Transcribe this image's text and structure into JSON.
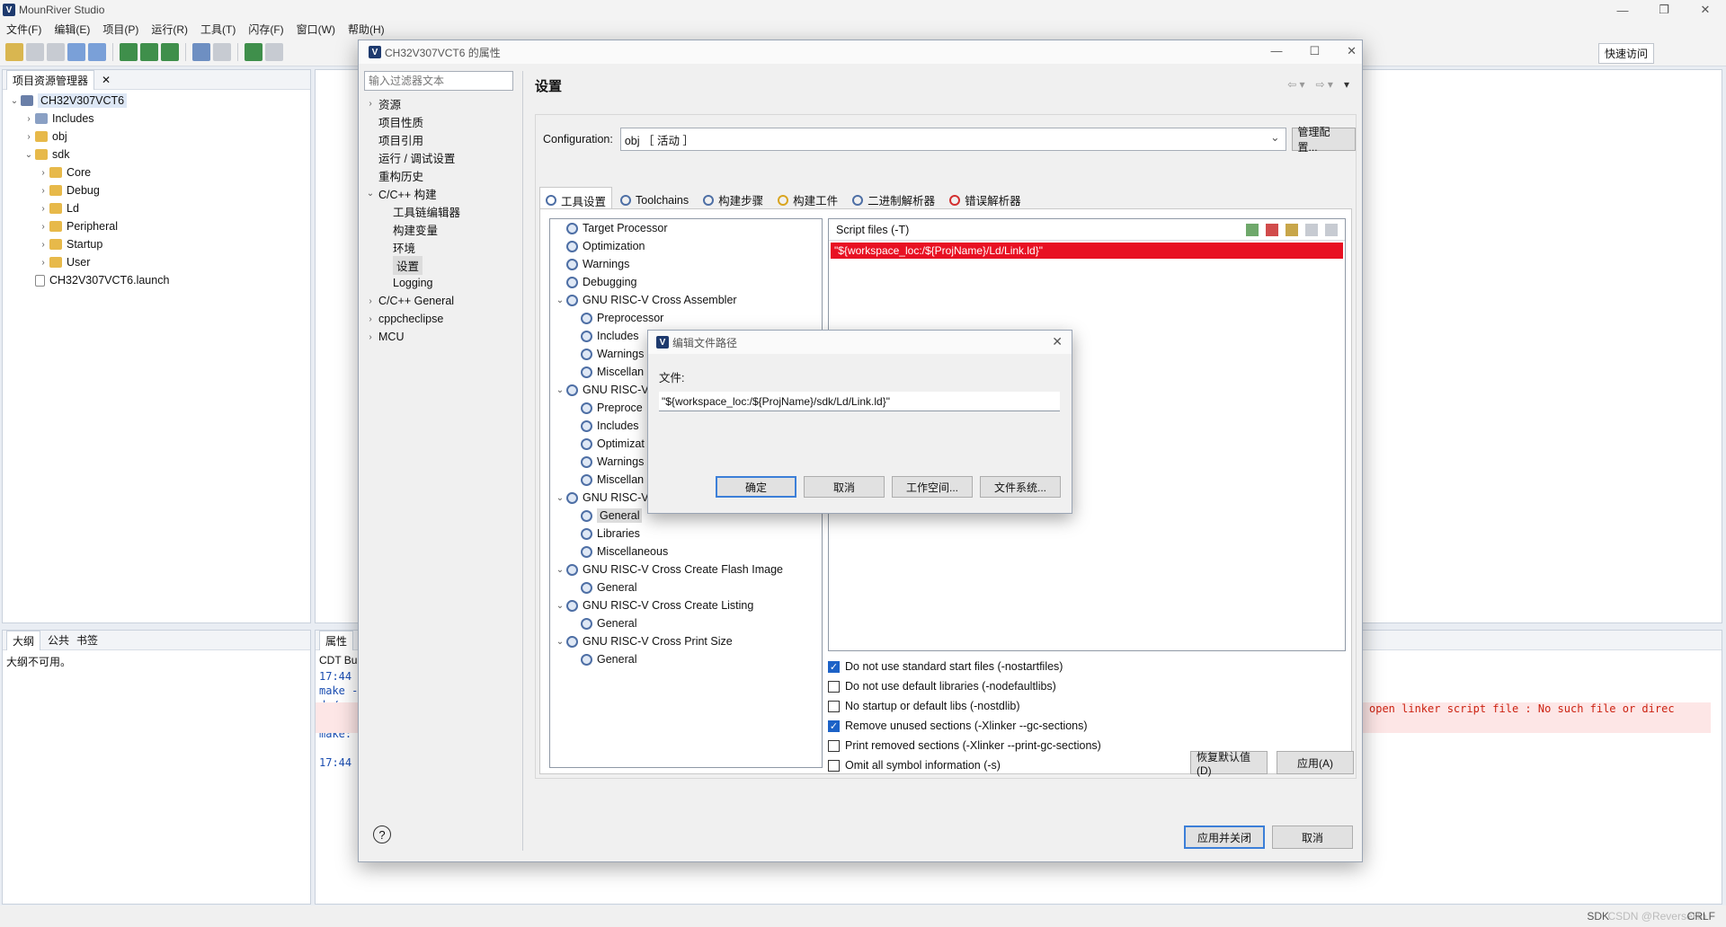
{
  "app": {
    "title": "MounRiver Studio"
  },
  "menu": [
    "文件(F)",
    "编辑(E)",
    "项目(P)",
    "运行(R)",
    "工具(T)",
    "闪存(F)",
    "窗口(W)",
    "帮助(H)"
  ],
  "toolbar": {
    "quick_access": "快速访问"
  },
  "project_explorer": {
    "tab": "项目资源管理器",
    "items": [
      {
        "label": "CH32V307VCT6",
        "level": 0,
        "expanded": true,
        "kind": "project"
      },
      {
        "label": "Includes",
        "level": 1,
        "expanded": false,
        "kind": "includes"
      },
      {
        "label": "obj",
        "level": 1,
        "expanded": false,
        "kind": "folder"
      },
      {
        "label": "sdk",
        "level": 1,
        "expanded": true,
        "kind": "folder"
      },
      {
        "label": "Core",
        "level": 2,
        "expanded": false,
        "kind": "folder"
      },
      {
        "label": "Debug",
        "level": 2,
        "expanded": false,
        "kind": "folder"
      },
      {
        "label": "Ld",
        "level": 2,
        "expanded": false,
        "kind": "folder"
      },
      {
        "label": "Peripheral",
        "level": 2,
        "expanded": false,
        "kind": "folder"
      },
      {
        "label": "Startup",
        "level": 2,
        "expanded": false,
        "kind": "folder"
      },
      {
        "label": "User",
        "level": 2,
        "expanded": false,
        "kind": "folder"
      },
      {
        "label": "CH32V307VCT6.launch",
        "level": 1,
        "expanded": null,
        "kind": "file"
      }
    ]
  },
  "outline": {
    "tabs": [
      "大纲",
      "公共",
      "书签"
    ],
    "message": "大纲不可用。"
  },
  "console": {
    "tab": "属性",
    "title": "CDT Bu",
    "lines": [
      "17:44",
      "make -",
      "d:/mo",
      "colle",
      "make:",
      "",
      "17:44"
    ],
    "error_line": "open linker script file : No such file or direc"
  },
  "properties_dialog": {
    "title": "CH32V307VCT6 的属性",
    "filter_placeholder": "输入过滤器文本",
    "nav": [
      {
        "label": "资源",
        "level": 0,
        "expander": "›",
        "selected": false
      },
      {
        "label": "项目性质",
        "level": 0,
        "expander": "",
        "selected": false
      },
      {
        "label": "项目引用",
        "level": 0,
        "expander": "",
        "selected": false
      },
      {
        "label": "运行 / 调试设置",
        "level": 0,
        "expander": "",
        "selected": false
      },
      {
        "label": "重构历史",
        "level": 0,
        "expander": "",
        "selected": false
      },
      {
        "label": "C/C++ 构建",
        "level": 0,
        "expander": "⌄",
        "selected": false
      },
      {
        "label": "工具链编辑器",
        "level": 1,
        "expander": "",
        "selected": false
      },
      {
        "label": "构建变量",
        "level": 1,
        "expander": "",
        "selected": false
      },
      {
        "label": "环境",
        "level": 1,
        "expander": "",
        "selected": false
      },
      {
        "label": "设置",
        "level": 1,
        "expander": "",
        "selected": true
      },
      {
        "label": "Logging",
        "level": 1,
        "expander": "",
        "selected": false
      },
      {
        "label": "C/C++ General",
        "level": 0,
        "expander": "›",
        "selected": false
      },
      {
        "label": "cppcheclipse",
        "level": 0,
        "expander": "›",
        "selected": false
      },
      {
        "label": "MCU",
        "level": 0,
        "expander": "›",
        "selected": false
      }
    ],
    "page_title": "设置",
    "configuration_label": "Configuration:",
    "configuration_value": "obj ［ 活动 ］",
    "manage_button": "管理配置...",
    "tabs": [
      "工具设置",
      "Toolchains",
      "构建步骤",
      "构建工件",
      "二进制解析器",
      "错误解析器"
    ],
    "tool_tree": [
      {
        "label": "Target Processor",
        "level": 0,
        "expander": ""
      },
      {
        "label": "Optimization",
        "level": 0,
        "expander": ""
      },
      {
        "label": "Warnings",
        "level": 0,
        "expander": ""
      },
      {
        "label": "Debugging",
        "level": 0,
        "expander": ""
      },
      {
        "label": "GNU RISC-V Cross Assembler",
        "level": 0,
        "expander": "⌄"
      },
      {
        "label": "Preprocessor",
        "level": 1,
        "expander": ""
      },
      {
        "label": "Includes",
        "level": 1,
        "expander": ""
      },
      {
        "label": "Warnings",
        "level": 1,
        "expander": ""
      },
      {
        "label": "Miscellan",
        "level": 1,
        "expander": ""
      },
      {
        "label": "GNU RISC-V",
        "level": 0,
        "expander": "⌄"
      },
      {
        "label": "Preproce",
        "level": 1,
        "expander": ""
      },
      {
        "label": "Includes",
        "level": 1,
        "expander": ""
      },
      {
        "label": "Optimizat",
        "level": 1,
        "expander": ""
      },
      {
        "label": "Warnings",
        "level": 1,
        "expander": ""
      },
      {
        "label": "Miscellan",
        "level": 1,
        "expander": ""
      },
      {
        "label": "GNU RISC-V",
        "level": 0,
        "expander": "⌄"
      },
      {
        "label": "General",
        "level": 1,
        "expander": "",
        "selected": true
      },
      {
        "label": "Libraries",
        "level": 1,
        "expander": ""
      },
      {
        "label": "Miscellaneous",
        "level": 1,
        "expander": ""
      },
      {
        "label": "GNU RISC-V Cross Create Flash Image",
        "level": 0,
        "expander": "⌄"
      },
      {
        "label": "General",
        "level": 1,
        "expander": ""
      },
      {
        "label": "GNU RISC-V Cross Create Listing",
        "level": 0,
        "expander": "⌄"
      },
      {
        "label": "General",
        "level": 1,
        "expander": ""
      },
      {
        "label": "GNU RISC-V Cross Print Size",
        "level": 0,
        "expander": "⌄"
      },
      {
        "label": "General",
        "level": 1,
        "expander": ""
      }
    ],
    "script_files_label": "Script files (-T)",
    "script_file": "\"${workspace_loc:/${ProjName}/Ld/Link.ld}\"",
    "options": [
      {
        "label": "Do not use standard start files (-nostartfiles)",
        "checked": true
      },
      {
        "label": "Do not use default libraries (-nodefaultlibs)",
        "checked": false
      },
      {
        "label": "No startup or default libs (-nostdlib)",
        "checked": false
      },
      {
        "label": "Remove unused sections (-Xlinker --gc-sections)",
        "checked": true
      },
      {
        "label": "Print removed sections (-Xlinker --print-gc-sections)",
        "checked": false
      },
      {
        "label": "Omit all symbol information (-s)",
        "checked": false
      }
    ],
    "restore_defaults": "恢复默认值(D)",
    "apply": "应用(A)",
    "apply_close": "应用并关闭",
    "cancel": "取消"
  },
  "edit_dialog": {
    "title": "编辑文件路径",
    "file_label": "文件:",
    "file_value": "\"${workspace_loc:/${ProjName}/sdk/Ld/Link.ld}\"",
    "ok": "确定",
    "cancel": "取消",
    "workspace": "工作空间...",
    "filesystem": "文件系统..."
  },
  "status": {
    "left": "SDK",
    "right": "CRLF",
    "watermark": "CSDN @ReverseHo"
  },
  "colors": {
    "accent": "#1c62c7",
    "error_row": "#e81123",
    "error_bg": "#fde6e6"
  }
}
